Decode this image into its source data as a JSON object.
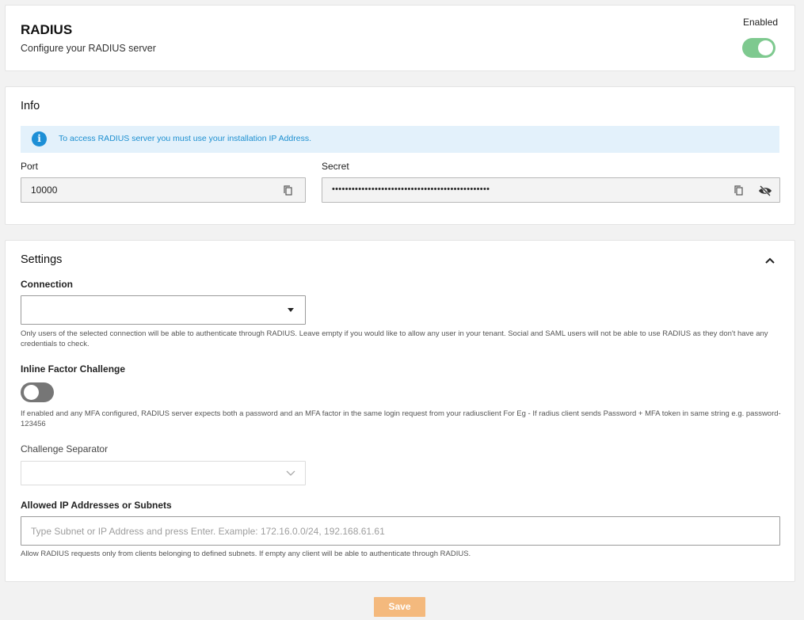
{
  "header": {
    "title": "RADIUS",
    "subtitle": "Configure your RADIUS server",
    "enabled_label": "Enabled",
    "enabled": true
  },
  "info": {
    "title": "Info",
    "banner_text": "To access RADIUS server you must use your installation IP Address.",
    "port_label": "Port",
    "port_value": "10000",
    "secret_label": "Secret",
    "secret_value": "••••••••••••••••••••••••••••••••••••••••••••••••"
  },
  "settings": {
    "title": "Settings",
    "connection_label": "Connection",
    "connection_value": "",
    "connection_help": "Only users of the selected connection will be able to authenticate through RADIUS. Leave empty if you would like to allow any user in your tenant. Social and SAML users will not be able to use RADIUS as they don't have any credentials to check.",
    "inline_factor_label": "Inline Factor Challenge",
    "inline_factor_enabled": false,
    "inline_factor_help": "If enabled and any MFA configured, RADIUS server expects both a password and an MFA factor in the same login request from your radiusclient For Eg - If radius client sends Password + MFA token in same string e.g. password-123456",
    "separator_label": "Challenge Separator",
    "separator_value": "",
    "allowed_ip_label": "Allowed IP Addresses or Subnets",
    "allowed_ip_placeholder": "Type Subnet or IP Address and press Enter. Example: 172.16.0.0/24, 192.168.61.61",
    "allowed_ip_help": "Allow RADIUS requests only from clients belonging to defined subnets. If empty any client will be able to authenticate through RADIUS."
  },
  "actions": {
    "save_label": "Save"
  },
  "colors": {
    "toggle_on": "#7ec98f",
    "toggle_off": "#767676",
    "info_blue": "#1d8fd6",
    "banner_bg": "#e3f1fb",
    "save_bg": "#f4b97d"
  },
  "icons": {
    "info": "info-icon",
    "copy": "copy-icon",
    "eye_off": "eye-off-icon",
    "chevron_up": "chevron-up-icon",
    "caret_down": "caret-down-icon",
    "chevron_down": "chevron-down-icon"
  }
}
